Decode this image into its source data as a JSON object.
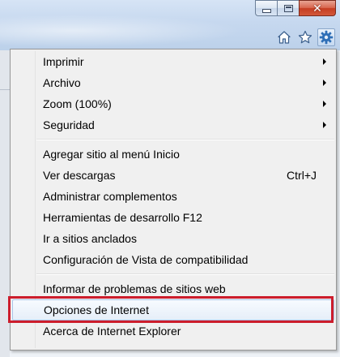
{
  "window": {
    "caption_buttons": {
      "minimize_icon": "minimize-icon",
      "maximize_icon": "maximize-icon",
      "close_glyph": "✕"
    },
    "toolbar_icons": [
      "home-icon",
      "star-icon",
      "gear-icon"
    ]
  },
  "menu": {
    "groups": [
      [
        {
          "label": "Imprimir",
          "submenu": true
        },
        {
          "label": "Archivo",
          "submenu": true
        },
        {
          "label": "Zoom (100%)",
          "submenu": true
        },
        {
          "label": "Seguridad",
          "submenu": true
        }
      ],
      [
        {
          "label": "Agregar sitio al menú Inicio"
        },
        {
          "label": "Ver descargas",
          "shortcut": "Ctrl+J"
        },
        {
          "label": "Administrar complementos"
        },
        {
          "label": "Herramientas de desarrollo F12"
        },
        {
          "label": "Ir a sitios anclados"
        },
        {
          "label": "Configuración de Vista de compatibilidad"
        }
      ],
      [
        {
          "label": "Informar de problemas de sitios web"
        },
        {
          "label": "Opciones de Internet",
          "highlighted": true
        },
        {
          "label": "Acerca de Internet Explorer"
        }
      ]
    ]
  },
  "colors": {
    "highlight_border": "#cc1d2c",
    "menu_background": "#f0f0f0"
  }
}
